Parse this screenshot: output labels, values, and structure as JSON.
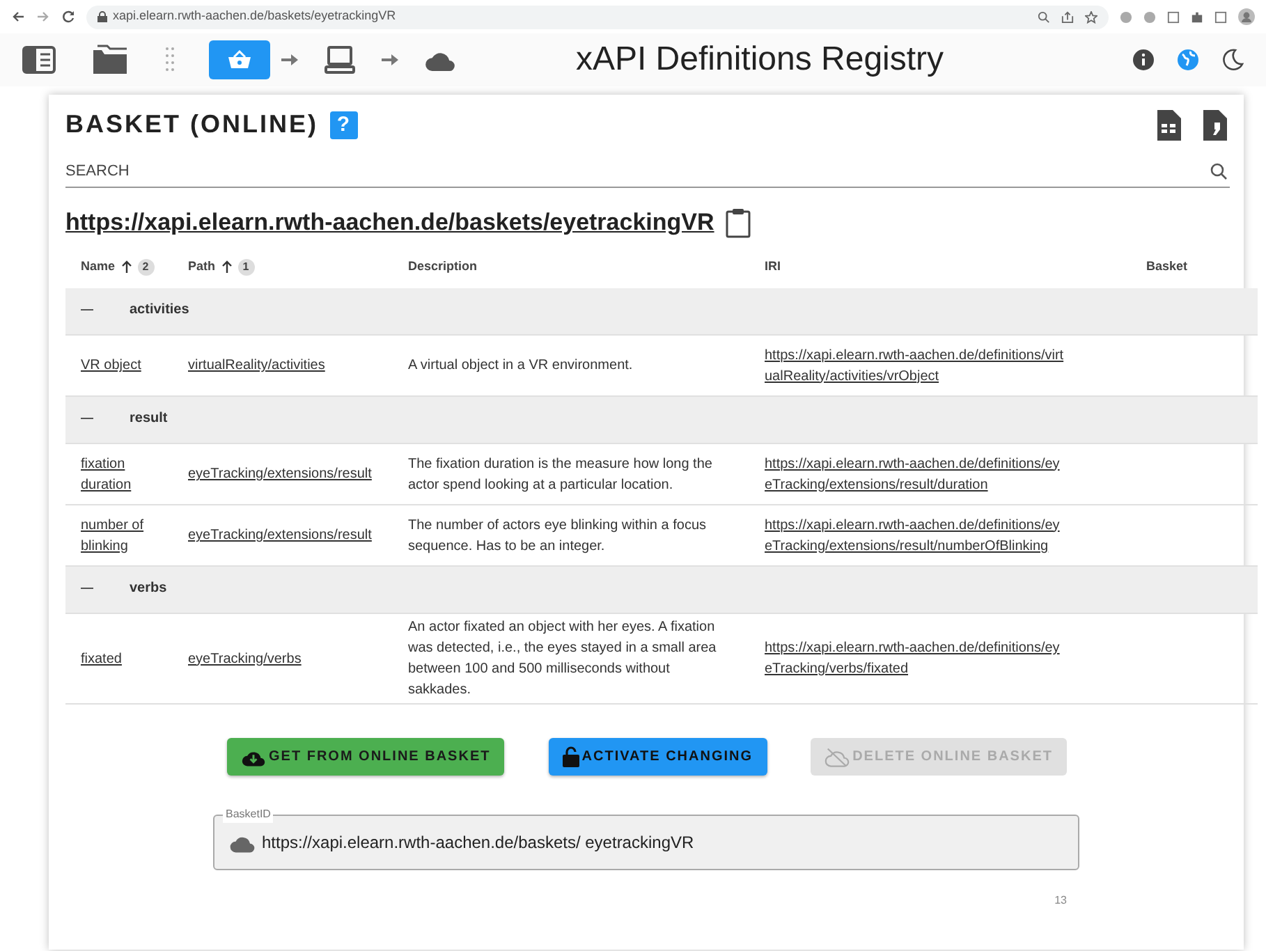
{
  "browser": {
    "url": "xapi.elearn.rwth-aachen.de/baskets/eyetrackingVR"
  },
  "toolbar": {
    "steps": [
      {
        "kind": "basket",
        "selected": true
      },
      {
        "kind": "computer",
        "selected": false
      },
      {
        "kind": "cloud",
        "selected": false
      }
    ],
    "title": "xAPI Definitions Registry",
    "language_selected": true
  },
  "basket": {
    "title": "BASKET (ONLINE)",
    "help": "?",
    "search": {
      "placeholder": "SEARCH"
    },
    "url": "https://xapi.elearn.rwth-aachen.de/baskets/eyetrackingVR",
    "columns": [
      {
        "label": "Name",
        "sorted": true,
        "sort_order": "2"
      },
      {
        "label": "Path",
        "sorted": true,
        "sort_order": "1"
      },
      {
        "label": "Description",
        "sorted": false
      },
      {
        "label": "IRI",
        "sorted": false
      },
      {
        "label": "Basket",
        "sorted": false
      }
    ],
    "groups": [
      {
        "name": "activities",
        "expanded": true,
        "rows": [
          {
            "name": "VR object",
            "path": "virtualReality/activities",
            "description": "A virtual object in a VR environment.",
            "iri": "https://xapi.elearn.rwth-aachen.de/definitions/virtualReality/activities/vrObject"
          }
        ]
      },
      {
        "name": "result",
        "expanded": true,
        "rows": [
          {
            "name": "fixation duration",
            "path": "eyeTracking/extensions/result",
            "description": "The fixation duration is the measure how long the actor spend looking at a particular location.",
            "iri": "https://xapi.elearn.rwth-aachen.de/definitions/eyeTracking/extensions/result/duration"
          },
          {
            "name": "number of blinking",
            "path": "eyeTracking/extensions/result",
            "description": "The number of actors eye blinking within a focus sequence. Has to be an integer.",
            "iri": "https://xapi.elearn.rwth-aachen.de/definitions/eyeTracking/extensions/result/numberOfBlinking"
          }
        ]
      },
      {
        "name": "verbs",
        "expanded": true,
        "rows": [
          {
            "name": "fixated",
            "path": "eyeTracking/verbs",
            "description": "An actor fixated an object with her eyes. A fixation was detected, i.e., the eyes stayed in a small area between 100 and 500 milliseconds without sakkades.",
            "iri": "https://xapi.elearn.rwth-aachen.de/definitions/eyeTracking/verbs/fixated"
          }
        ]
      }
    ],
    "buttons": [
      {
        "label": "GET FROM ONLINE BASKET",
        "kind": "get",
        "disabled": false
      },
      {
        "label": "ACTIVATE CHANGING",
        "kind": "activate",
        "disabled": false
      },
      {
        "label": "DELETE ONLINE BASKET",
        "kind": "delete",
        "disabled": true
      }
    ],
    "basket_id": {
      "label": "BasketID",
      "value": "https://xapi.elearn.rwth-aachen.de/baskets/ eyetrackingVR",
      "counter": "13"
    }
  }
}
